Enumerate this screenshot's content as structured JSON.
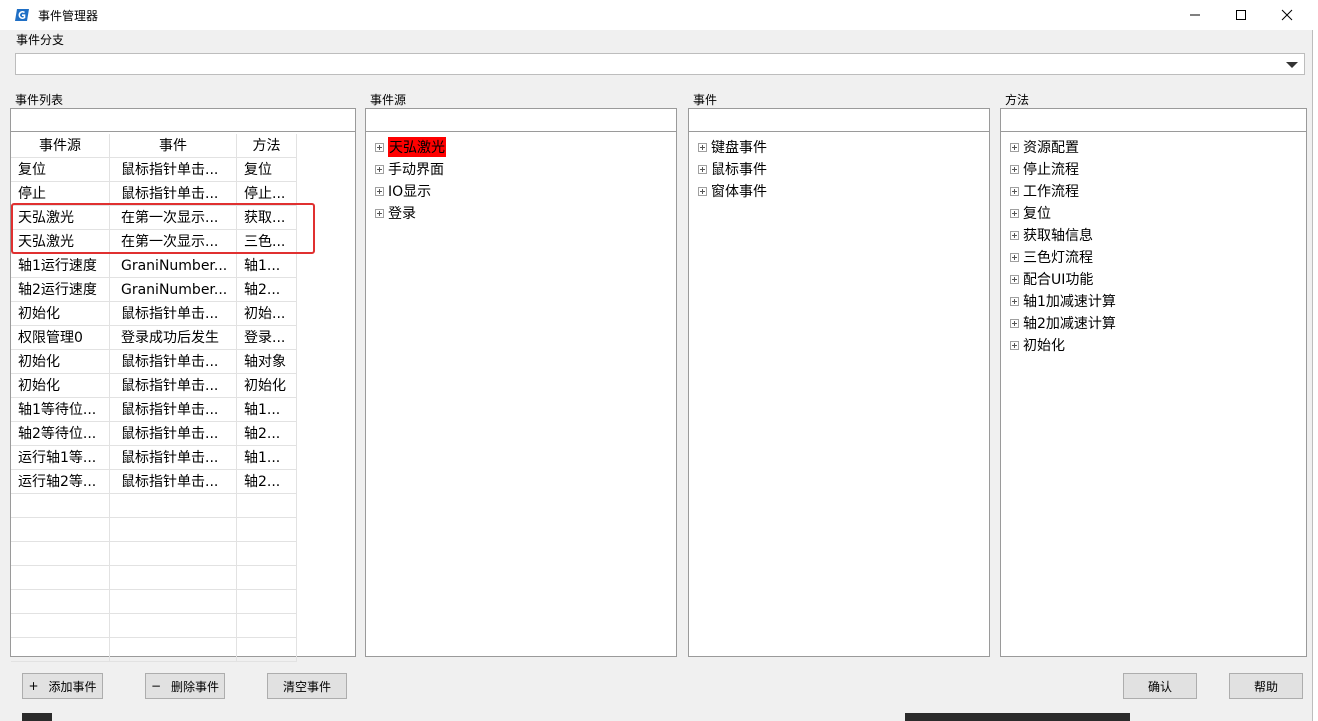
{
  "window": {
    "title": "事件管理器"
  },
  "branch": {
    "label": "事件分支",
    "value": ""
  },
  "event_list": {
    "label": "事件列表",
    "search_value": "",
    "columns": [
      "事件源",
      "事件",
      "方法"
    ],
    "rows": [
      [
        "复位",
        "鼠标指针单击...",
        "复位"
      ],
      [
        "停止",
        "鼠标指针单击...",
        "停止..."
      ],
      [
        "天弘激光",
        "在第一次显示...",
        "获取..."
      ],
      [
        "天弘激光",
        "在第一次显示...",
        "三色..."
      ],
      [
        "轴1运行速度",
        "GraniNumber...",
        "轴1..."
      ],
      [
        "轴2运行速度",
        "GraniNumber...",
        "轴2..."
      ],
      [
        "初始化",
        "鼠标指针单击...",
        "初始..."
      ],
      [
        "权限管理0",
        "登录成功后发生",
        "登录..."
      ],
      [
        "初始化",
        "鼠标指针单击...",
        "轴对象"
      ],
      [
        "初始化",
        "鼠标指针单击...",
        "初始化"
      ],
      [
        "轴1等待位...",
        "鼠标指针单击...",
        "轴1..."
      ],
      [
        "轴2等待位...",
        "鼠标指针单击...",
        "轴2..."
      ],
      [
        "运行轴1等...",
        "鼠标指针单击...",
        "轴1..."
      ],
      [
        "运行轴2等...",
        "鼠标指针单击...",
        "轴2..."
      ]
    ]
  },
  "event_source": {
    "label": "事件源",
    "search_value": "",
    "items": [
      "天弘激光",
      "手动界面",
      "IO显示",
      "登录"
    ],
    "selected": "天弘激光"
  },
  "events": {
    "label": "事件",
    "search_value": "",
    "items": [
      "键盘事件",
      "鼠标事件",
      "窗体事件"
    ]
  },
  "methods": {
    "label": "方法",
    "search_value": "",
    "items": [
      "资源配置",
      "停止流程",
      "工作流程",
      "复位",
      "获取轴信息",
      "三色灯流程",
      "配合UI功能",
      "轴1加减速计算",
      "轴2加减速计算",
      "初始化"
    ]
  },
  "buttons": {
    "add": "添加事件",
    "add_prefix": "+",
    "delete": "删除事件",
    "delete_prefix": "−",
    "clear": "清空事件",
    "confirm": "确认",
    "help": "帮助"
  },
  "colors": {
    "selection": "#ff0000",
    "highlight_box": "#e03030"
  }
}
